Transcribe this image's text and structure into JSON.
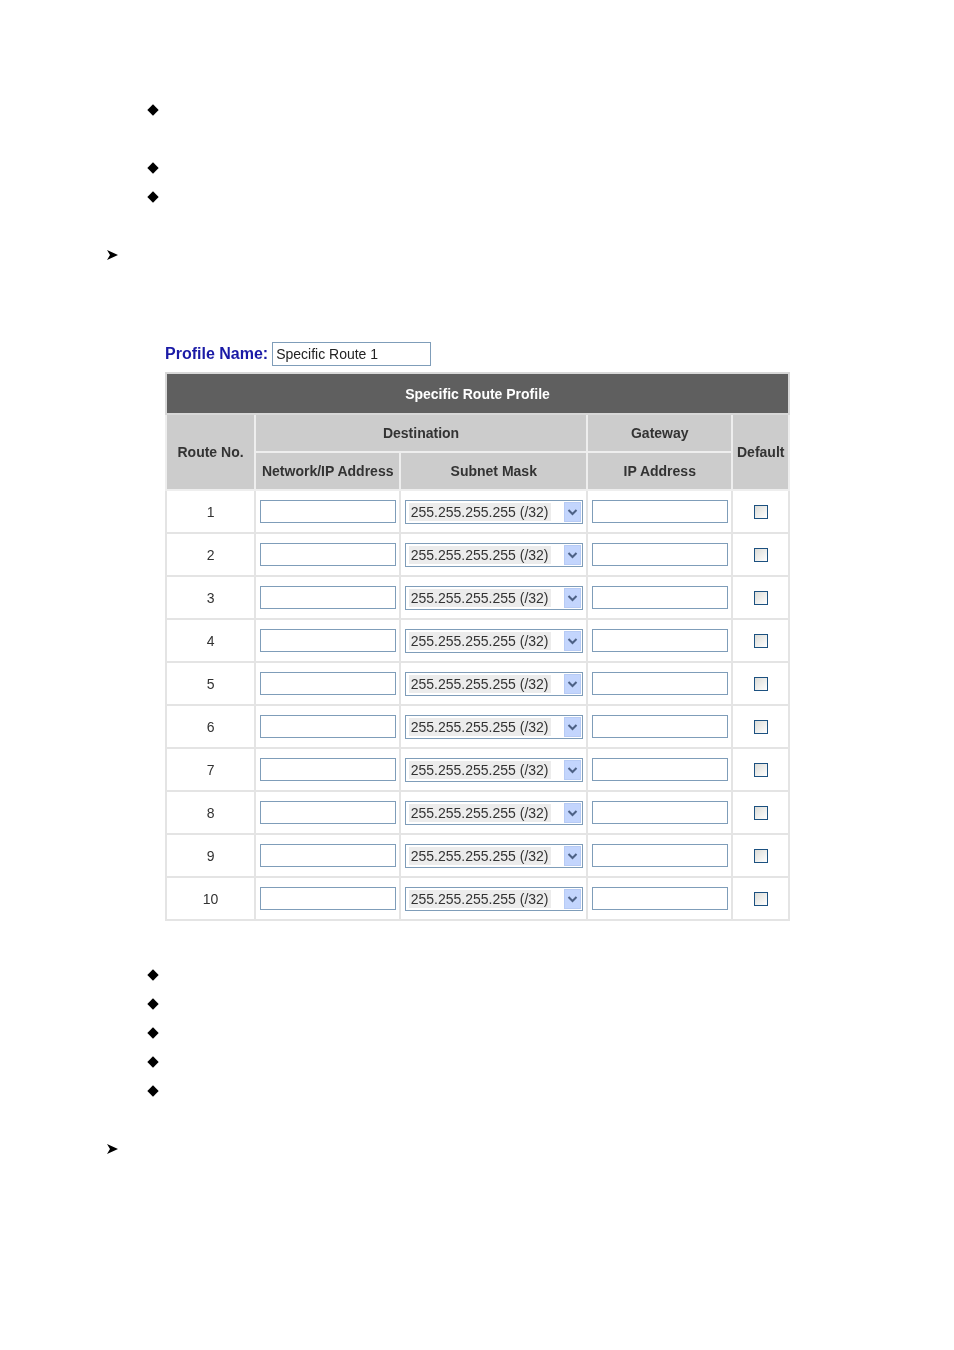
{
  "top_marks": [
    {
      "kind": "diamond"
    },
    {
      "kind": "diamond"
    },
    {
      "kind": "diamond"
    },
    {
      "kind": "arrow"
    }
  ],
  "profile": {
    "label": "Profile Name:",
    "value": "Specific Route 1"
  },
  "table": {
    "title": "Specific Route Profile",
    "headers": {
      "route_no": "Route No.",
      "destination": "Destination",
      "gateway": "Gateway",
      "default": "Default",
      "network": "Network/IP Address",
      "subnet": "Subnet Mask",
      "ip": "IP Address"
    },
    "rows": [
      {
        "route_no": "1",
        "subnet_mask": "255.255.255.255 (/32)",
        "default": false
      },
      {
        "route_no": "2",
        "subnet_mask": "255.255.255.255 (/32)",
        "default": false
      },
      {
        "route_no": "3",
        "subnet_mask": "255.255.255.255 (/32)",
        "default": false
      },
      {
        "route_no": "4",
        "subnet_mask": "255.255.255.255 (/32)",
        "default": false
      },
      {
        "route_no": "5",
        "subnet_mask": "255.255.255.255 (/32)",
        "default": false
      },
      {
        "route_no": "6",
        "subnet_mask": "255.255.255.255 (/32)",
        "default": false
      },
      {
        "route_no": "7",
        "subnet_mask": "255.255.255.255 (/32)",
        "default": false
      },
      {
        "route_no": "8",
        "subnet_mask": "255.255.255.255 (/32)",
        "default": false
      },
      {
        "route_no": "9",
        "subnet_mask": "255.255.255.255 (/32)",
        "default": false
      },
      {
        "route_no": "10",
        "subnet_mask": "255.255.255.255 (/32)",
        "default": false
      }
    ]
  },
  "bottom_marks": [
    {
      "kind": "diamond"
    },
    {
      "kind": "diamond"
    },
    {
      "kind": "diamond"
    },
    {
      "kind": "diamond"
    },
    {
      "kind": "diamond"
    },
    {
      "kind": "arrow"
    }
  ]
}
